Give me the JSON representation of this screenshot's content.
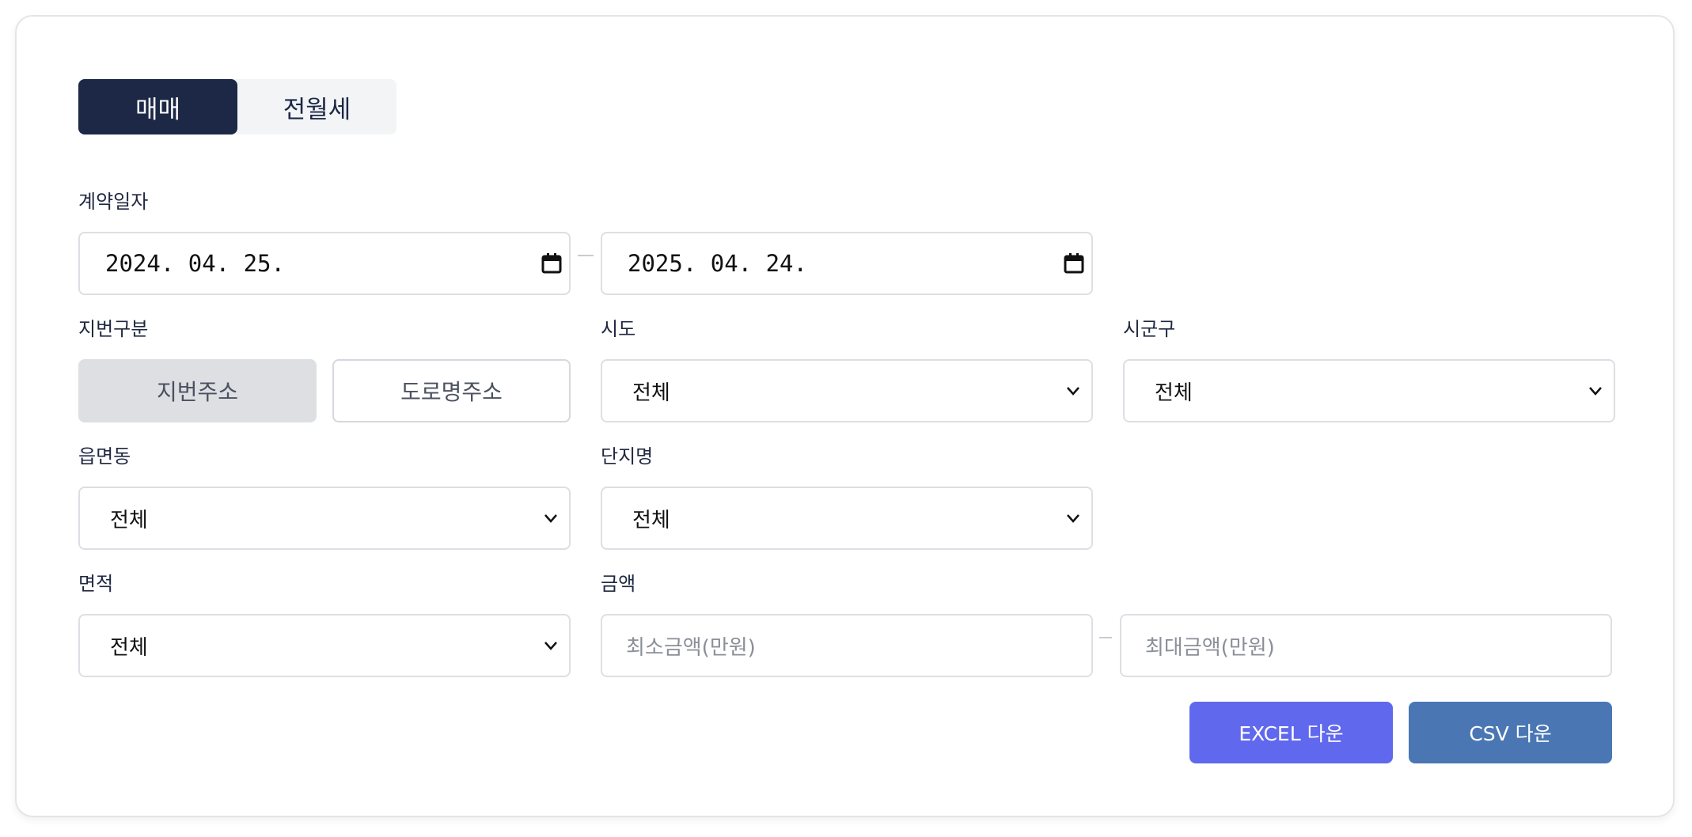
{
  "trade_tabs": {
    "sale": "매매",
    "rent": "전월세"
  },
  "contract_date": {
    "label": "계약일자",
    "start": "2024. 04. 25.",
    "end": "2025. 04. 24."
  },
  "address_type": {
    "label": "지번구분",
    "lot": "지번주소",
    "road": "도로명주소"
  },
  "sido": {
    "label": "시도",
    "value": "전체"
  },
  "sigungu": {
    "label": "시군구",
    "value": "전체"
  },
  "eupmyeondong": {
    "label": "읍면동",
    "value": "전체"
  },
  "complex": {
    "label": "단지명",
    "value": "전체"
  },
  "area": {
    "label": "면적",
    "value": "전체"
  },
  "price": {
    "label": "금액",
    "min_placeholder": "최소금액(만원)",
    "max_placeholder": "최대금액(만원)"
  },
  "actions": {
    "excel": "EXCEL 다운",
    "csv": "CSV 다운"
  },
  "colors": {
    "active_tab": "#1c2845",
    "excel_button": "#6068ee",
    "csv_button": "#4a77b4"
  }
}
